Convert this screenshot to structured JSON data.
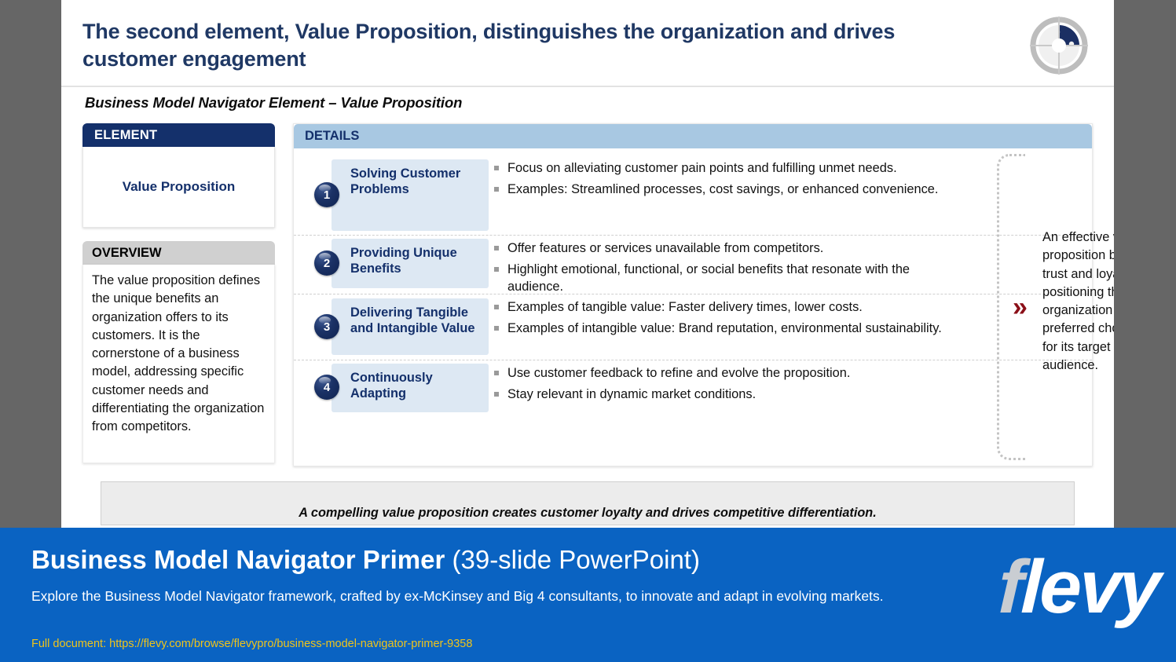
{
  "slide": {
    "title": "The second element, Value Proposition, distinguishes the organization and drives customer engagement",
    "subtitle": "Business Model Navigator Element –  Value Proposition",
    "logo_icon": "puzzle-donut-logo"
  },
  "left_panel": {
    "element_header": "ELEMENT",
    "element_name": "Value Proposition",
    "overview_header": "OVERVIEW",
    "overview_text": "The value proposition defines the unique benefits an organization offers to its customers. It is the cornerstone of a business model, addressing specific customer needs and differentiating the organization from competitors."
  },
  "right_panel": {
    "details_header": "DETAILS",
    "rows": [
      {
        "number": "1",
        "label": "Solving Customer Problems",
        "bullets": [
          "Focus on alleviating customer pain points and fulfilling unmet needs.",
          "Examples: Streamlined processes, cost savings, or enhanced convenience."
        ]
      },
      {
        "number": "2",
        "label": "Providing Unique Benefits",
        "bullets": [
          "Offer features or services unavailable from competitors.",
          "Highlight emotional, functional, or social benefits that resonate with the audience."
        ]
      },
      {
        "number": "3",
        "label": "Delivering Tangible and Intangible Value",
        "bullets": [
          "Examples of tangible value: Faster delivery times, lower costs.",
          "Examples of intangible value: Brand reputation, environmental sustainability."
        ]
      },
      {
        "number": "4",
        "label": "Continuously Adapting",
        "bullets": [
          "Use customer feedback to refine and evolve the proposition.",
          "Stay relevant in dynamic market conditions."
        ]
      }
    ],
    "callout": {
      "chevron_icon": "double-chevron-right-icon",
      "text": "An effective value proposition builds trust and loyalty, positioning the organization as the preferred choice for its target audience."
    }
  },
  "footnote": {
    "text": "A compelling value proposition creates customer loyalty and drives competitive differentiation."
  },
  "banner": {
    "title_bold": "Business Model Navigator Primer",
    "title_rest": " (39-slide PowerPoint)",
    "description": "Explore the Business Model Navigator framework, crafted by ex-McKinsey and Big 4 consultants, to innovate and adapt in evolving markets.",
    "link": "Full document: https://flevy.com/browse/flevypro/business-model-navigator-primer-9358",
    "logo_f": "f",
    "logo_rest": "levy"
  },
  "colors": {
    "navy": "#14306b",
    "light_blue": "#a8c8e2",
    "step_box": "#dde8f3",
    "banner_blue": "#0a63c2",
    "link_yellow": "#f0c419",
    "chevron_red": "#8b0f18",
    "page_bg": "#666666"
  }
}
